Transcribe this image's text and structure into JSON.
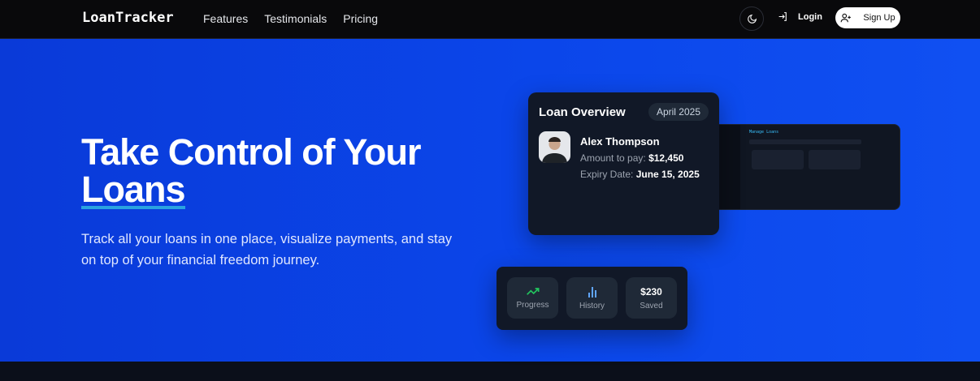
{
  "nav": {
    "logo": "LoanTracker",
    "links": [
      "Features",
      "Testimonials",
      "Pricing"
    ],
    "login": "Login",
    "signup": "Sign Up"
  },
  "hero": {
    "title_line1": "Take Control of Your",
    "title_line2": "Loans",
    "subtitle": "Track all your loans in one place, visualize payments, and stay on top of your financial freedom journey."
  },
  "overview": {
    "title": "Loan Overview",
    "month": "April 2025",
    "name": "Alex Thompson",
    "amount_label": "Amount to pay:",
    "amount": "$12,450",
    "expiry_label": "Expiry Date:",
    "expiry": "June 15, 2025"
  },
  "preview": {
    "title": "Manage Loans"
  },
  "stats": {
    "progress": "Progress",
    "history": "History",
    "saved_value": "$230",
    "saved": "Saved"
  },
  "colors": {
    "accent": "#0b46ea",
    "underline": "#2aa3e0",
    "progress_icon": "#22c55e",
    "history_icon": "#60a5fa"
  }
}
